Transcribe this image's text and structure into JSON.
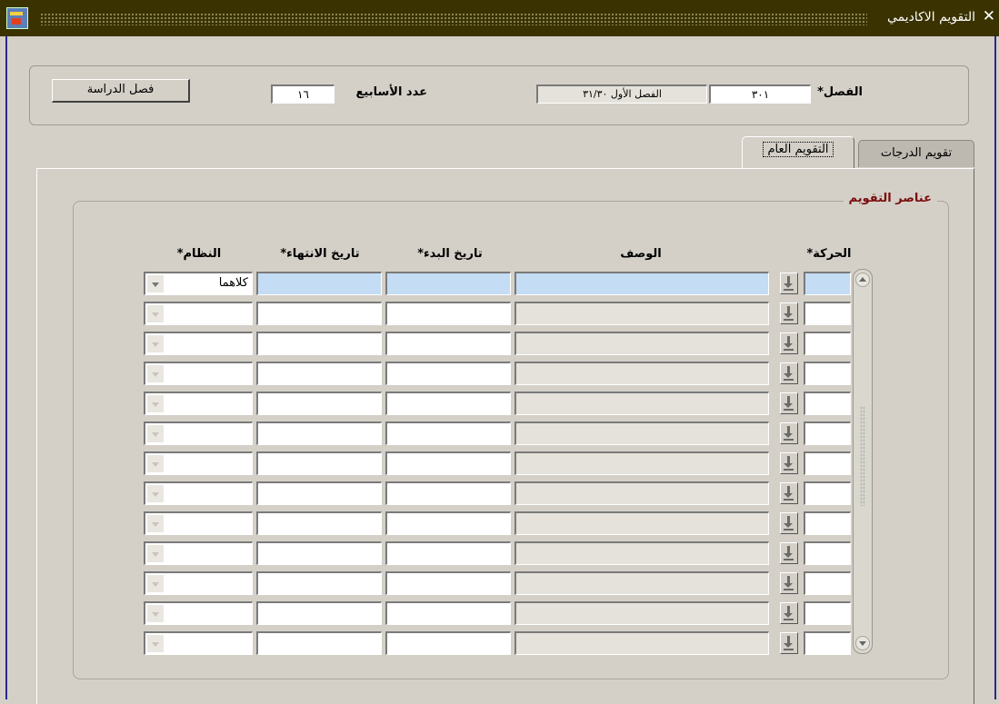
{
  "window": {
    "title": "التقويم الاكاديمي",
    "close_glyph": "✕"
  },
  "header": {
    "semester_label": "الفصل*",
    "semester_code": "٣٠١",
    "semester_desc": "الفصل الأول ٣١/٣٠",
    "weeks_label": "عدد الأسابيع",
    "weeks_value": "١٦",
    "study_semester_button": "فصل الدراسة"
  },
  "tabs": [
    {
      "label": "تقويم الدرجات",
      "active": false
    },
    {
      "label": "التقويم العام",
      "active": true
    }
  ],
  "group": {
    "title": "عناصر التقويم"
  },
  "table": {
    "headers": {
      "movement": "الحركة*",
      "description": "الوصف",
      "start_date": "تاريخ البدء*",
      "end_date": "تاريخ الانتهاء*",
      "system": "النظام*"
    },
    "rows": [
      {
        "movement": "",
        "description": "",
        "start_date": "",
        "end_date": "",
        "system": "كلاهما"
      },
      {
        "movement": "",
        "description": "",
        "start_date": "",
        "end_date": "",
        "system": ""
      },
      {
        "movement": "",
        "description": "",
        "start_date": "",
        "end_date": "",
        "system": ""
      },
      {
        "movement": "",
        "description": "",
        "start_date": "",
        "end_date": "",
        "system": ""
      },
      {
        "movement": "",
        "description": "",
        "start_date": "",
        "end_date": "",
        "system": ""
      },
      {
        "movement": "",
        "description": "",
        "start_date": "",
        "end_date": "",
        "system": ""
      },
      {
        "movement": "",
        "description": "",
        "start_date": "",
        "end_date": "",
        "system": ""
      },
      {
        "movement": "",
        "description": "",
        "start_date": "",
        "end_date": "",
        "system": ""
      },
      {
        "movement": "",
        "description": "",
        "start_date": "",
        "end_date": "",
        "system": ""
      },
      {
        "movement": "",
        "description": "",
        "start_date": "",
        "end_date": "",
        "system": ""
      },
      {
        "movement": "",
        "description": "",
        "start_date": "",
        "end_date": "",
        "system": ""
      },
      {
        "movement": "",
        "description": "",
        "start_date": "",
        "end_date": "",
        "system": ""
      },
      {
        "movement": "",
        "description": "",
        "start_date": "",
        "end_date": "",
        "system": ""
      }
    ]
  },
  "icons": {
    "app": "app-icon",
    "close": "close-icon",
    "lov": "lov-download-icon",
    "dropdown": "chevron-down-icon",
    "scroll_up": "scroll-up-icon",
    "scroll_down": "scroll-down-icon"
  },
  "colors": {
    "titlebar": "#3a3200",
    "window_border": "#2a2a8a",
    "group_title": "#7a0c0c",
    "current_record": "#c4dcf4",
    "readonly_field": "#e4e2da"
  }
}
